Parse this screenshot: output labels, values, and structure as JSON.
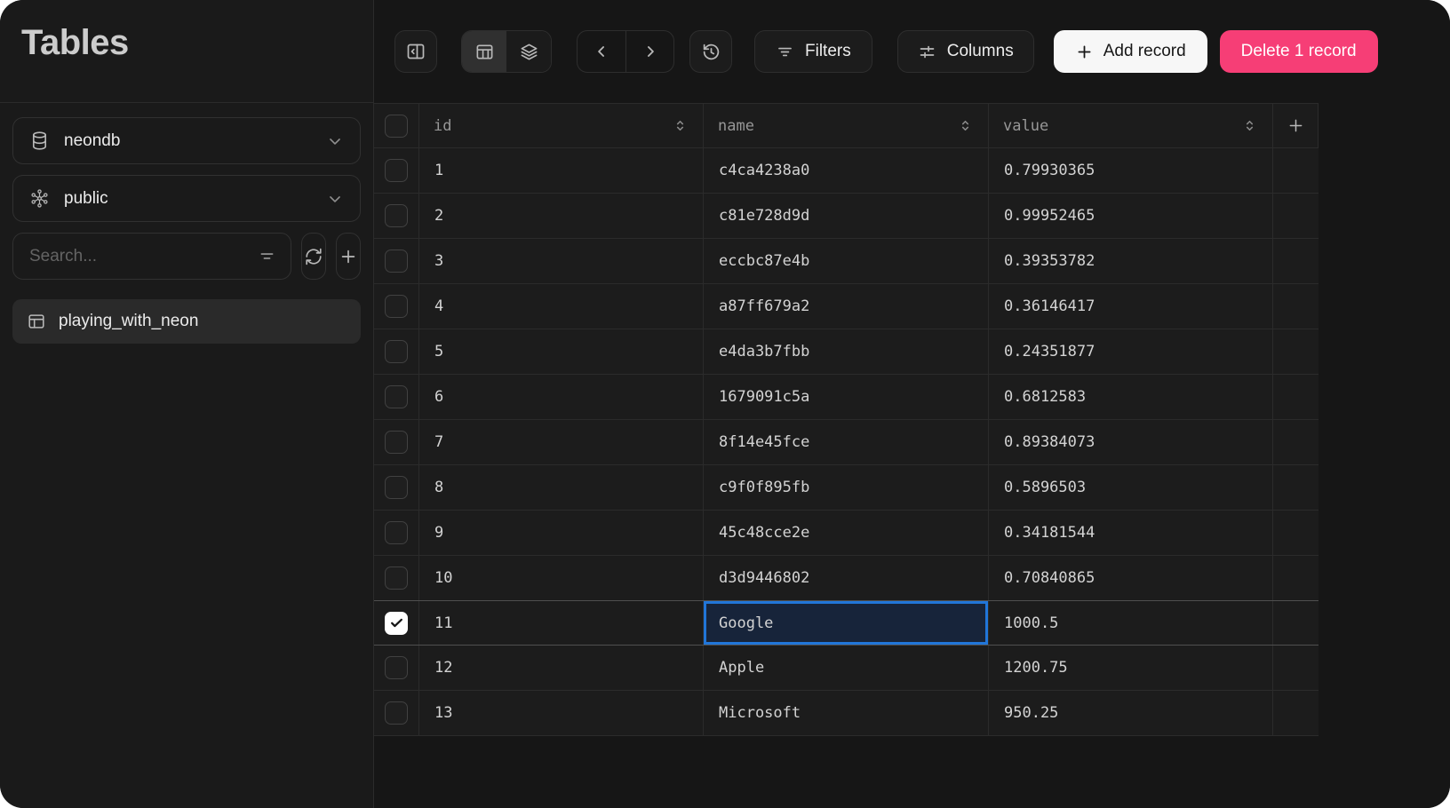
{
  "sidebar": {
    "title": "Tables",
    "database_select": {
      "value": "neondb",
      "icon": "database-icon"
    },
    "schema_select": {
      "value": "public",
      "icon": "schema-icon"
    },
    "search": {
      "placeholder": "Search..."
    },
    "table_items": [
      {
        "label": "playing_with_neon",
        "selected": true
      }
    ]
  },
  "toolbar": {
    "filters_label": "Filters",
    "columns_label": "Columns",
    "add_record_label": "Add record",
    "delete_label": "Delete 1 record"
  },
  "grid": {
    "columns": [
      {
        "key": "id",
        "label": "id",
        "sortable": true
      },
      {
        "key": "name",
        "label": "name",
        "sortable": true
      },
      {
        "key": "value",
        "label": "value",
        "sortable": true
      }
    ],
    "rows": [
      {
        "id": "1",
        "name": "c4ca4238a0",
        "value": "0.79930365",
        "checked": false
      },
      {
        "id": "2",
        "name": "c81e728d9d",
        "value": "0.99952465",
        "checked": false
      },
      {
        "id": "3",
        "name": "eccbc87e4b",
        "value": "0.39353782",
        "checked": false
      },
      {
        "id": "4",
        "name": "a87ff679a2",
        "value": "0.36146417",
        "checked": false
      },
      {
        "id": "5",
        "name": "e4da3b7fbb",
        "value": "0.24351877",
        "checked": false
      },
      {
        "id": "6",
        "name": "1679091c5a",
        "value": "0.6812583",
        "checked": false
      },
      {
        "id": "7",
        "name": "8f14e45fce",
        "value": "0.89384073",
        "checked": false
      },
      {
        "id": "8",
        "name": "c9f0f895fb",
        "value": "0.5896503",
        "checked": false
      },
      {
        "id": "9",
        "name": "45c48cce2e",
        "value": "0.34181544",
        "checked": false
      },
      {
        "id": "10",
        "name": "d3d9446802",
        "value": "0.70840865",
        "checked": false
      },
      {
        "id": "11",
        "name": "Google",
        "value": "1000.5",
        "checked": true,
        "selected_cell": "name"
      },
      {
        "id": "12",
        "name": "Apple",
        "value": "1200.75",
        "checked": false
      },
      {
        "id": "13",
        "name": "Microsoft",
        "value": "950.25",
        "checked": false
      }
    ],
    "selection": {
      "checked_row_count": 1,
      "selected_row_id": "11",
      "selected_cell_column": "name"
    }
  },
  "icons": {
    "panel-collapse-icon": "rectangle with divider and left chevron",
    "table-view-icon": "grid table",
    "layers-view-icon": "stacked layers",
    "prev-icon": "chevron-left",
    "next-icon": "chevron-right",
    "history-icon": "clock with counterclockwise arrow",
    "filter-lines-icon": "three shrinking horizontal lines",
    "sliders-icon": "horizontal sliders with handles",
    "plus-icon": "+",
    "database-icon": "database cylinder",
    "schema-icon": "hexagonal node graph",
    "refresh-icon": "circular arrows",
    "search-filter-icon": "funnel lines",
    "table-icon": "table grid",
    "chevron-down-icon": "chevron down",
    "sort-icon": "up and down chevrons",
    "check-icon": "checkmark"
  },
  "colors": {
    "accent_blue": "#2176d9",
    "danger_pink": "#f63e76",
    "selected_cell_bg": "#17243a",
    "app_bg": "#161616",
    "sidebar_bg": "#1a1a1a",
    "cell_bg": "#1c1c1c",
    "border": "#2b2b2b"
  }
}
